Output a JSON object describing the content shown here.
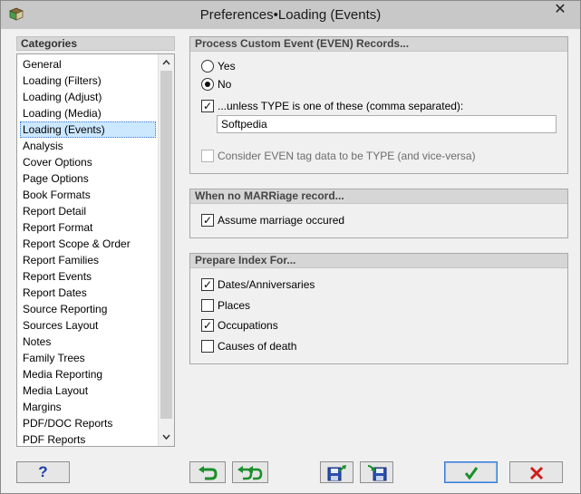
{
  "window": {
    "title": "Preferences•Loading (Events)",
    "close_glyph": "✕",
    "icon": "app-book-icon"
  },
  "categories": {
    "header": "Categories",
    "items": [
      "General",
      "Loading (Filters)",
      "Loading (Adjust)",
      "Loading (Media)",
      "Loading (Events)",
      "Analysis",
      "Cover Options",
      "Page Options",
      "Book Formats",
      "Report Detail",
      "Report Format",
      "Report Scope & Order",
      "Report Families",
      "Report Events",
      "Report Dates",
      "Source Reporting",
      "Sources Layout",
      "Notes",
      "Family Trees",
      "Media Reporting",
      "Media Layout",
      "Margins",
      "PDF/DOC Reports",
      "PDF Reports"
    ],
    "selected_index": 4
  },
  "group_custom_event": {
    "header": "Process Custom Event (EVEN) Records...",
    "yes_label": "Yes",
    "no_label": "No",
    "selected": "No",
    "unless_label": "...unless TYPE is one of these (comma separated):",
    "unless_checked": true,
    "types_value": "Softpedia",
    "consider_label": "Consider EVEN tag data to be TYPE (and vice-versa)",
    "consider_checked": false
  },
  "group_marriage": {
    "header": "When no MARRiage record...",
    "assume_label": "Assume marriage occured",
    "assume_checked": true
  },
  "group_index": {
    "header": "Prepare Index For...",
    "items": [
      {
        "label": "Dates/Anniversaries",
        "checked": true
      },
      {
        "label": "Places",
        "checked": false
      },
      {
        "label": "Occupations",
        "checked": true
      },
      {
        "label": "Causes of death",
        "checked": false
      }
    ]
  },
  "buttons": {
    "help_label": "?",
    "check_glyph": "✓",
    "colors": {
      "accent_blue": "#1b3da8",
      "green": "#1a8f2a",
      "red": "#d01c1c",
      "selection": "#cce8ff"
    }
  }
}
